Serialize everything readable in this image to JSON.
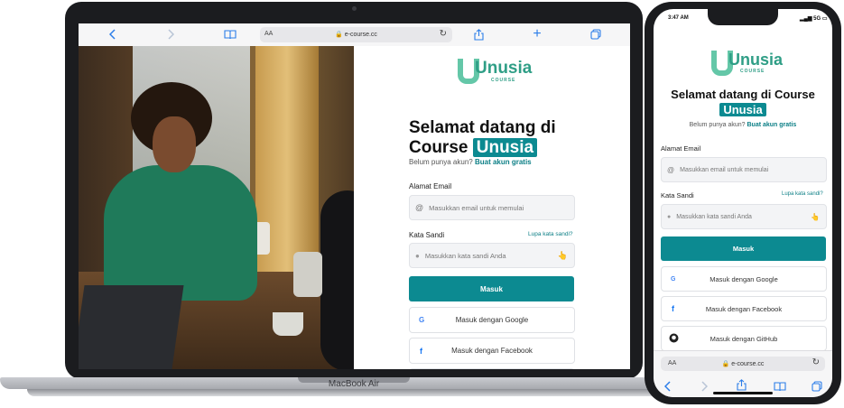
{
  "browser": {
    "url": "e-course.cc",
    "text_size_label": "AA"
  },
  "laptop": {
    "model_label": "MacBook Air"
  },
  "brand": {
    "name": "Unusia",
    "sub": "COURSE"
  },
  "login": {
    "title_line1": "Selamat datang di",
    "title_line2_prefix": "Course",
    "title_highlight": "Unusia",
    "no_account_text": "Belum punya akun?",
    "create_account_link": "Buat akun gratis",
    "email_label": "Alamat Email",
    "email_placeholder": "Masukkan email untuk memulai",
    "password_label": "Kata Sandi",
    "forgot_password_link": "Lupa kata sandi?",
    "password_placeholder": "Masukkan kata sandi Anda",
    "submit_label": "Masuk",
    "google_label": "Masuk dengan Google",
    "facebook_label": "Masuk dengan Facebook",
    "github_label": "Masuk dengan GitHub"
  },
  "phone": {
    "time": "3:47 AM",
    "network": "5G",
    "title_line1": "Selamat datang di Course",
    "title_highlight": "Unusia"
  },
  "colors": {
    "accent": "#0c8a91",
    "brand": "#64c7a8"
  }
}
